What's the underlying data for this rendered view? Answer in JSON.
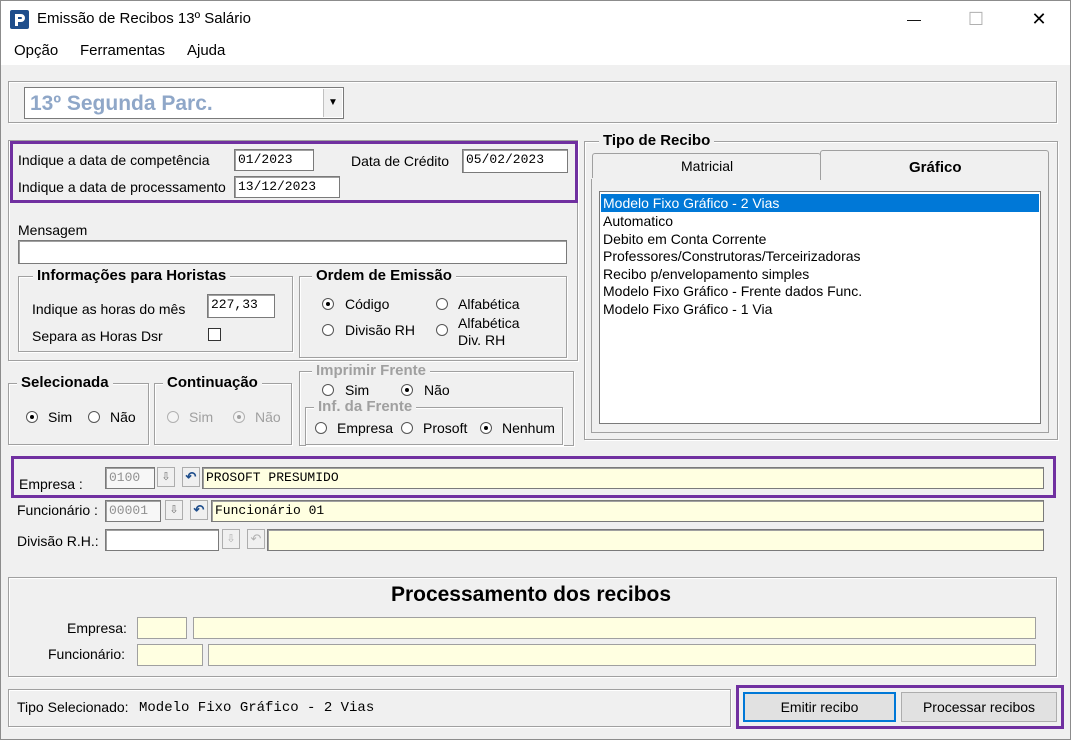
{
  "window": {
    "title": "Emissão de Recibos 13º Salário",
    "minimize": "—",
    "maximize": "☐",
    "close": "✕"
  },
  "menu": [
    "Opção",
    "Ferramentas",
    "Ajuda"
  ],
  "parcel_select": {
    "value": "13º Segunda Parc."
  },
  "dates": {
    "competencia_label": "Indique a data de competência",
    "competencia_value": "01/2023",
    "processamento_label": "Indique a data de processamento",
    "processamento_value": "13/12/2023",
    "credito_label": "Data de Crédito",
    "credito_value": "05/02/2023"
  },
  "mensagem": {
    "label": "Mensagem",
    "value": ""
  },
  "horistas": {
    "title": "Informações para Horistas",
    "horas_label": "Indique as horas do mês",
    "horas_value": "227,33",
    "separa_label": "Separa as Horas Dsr"
  },
  "ordem": {
    "title": "Ordem de Emissão",
    "options": [
      "Código",
      "Alfabética",
      "Divisão RH",
      "Alfabética",
      "Div.  RH"
    ]
  },
  "selecionada": {
    "title": "Selecionada",
    "sim": "Sim",
    "nao": "Não"
  },
  "continuacao": {
    "title": "Continuação",
    "sim": "Sim",
    "nao": "Não"
  },
  "imprimir_frente": {
    "title": "Imprimir Frente",
    "sim": "Sim",
    "nao": "Não"
  },
  "inf_frente": {
    "title": "Inf. da Frente",
    "empresa": "Empresa",
    "prosoft": "Prosoft",
    "nenhum": "Nenhum"
  },
  "tipo_recibo": {
    "title": "Tipo de Recibo",
    "tabs": [
      "Matricial",
      "Gráfico"
    ],
    "items": [
      "Modelo Fixo Gráfico - 2 Vias",
      "Automatico",
      "Debito em Conta Corrente",
      "Professores/Construtoras/Terceirizadoras",
      "Recibo p/envelopamento simples",
      "Modelo Fixo Gráfico - Frente dados Func.",
      "Modelo Fixo Gráfico - 1 Via"
    ]
  },
  "empresa": {
    "label": "Empresa :",
    "code": "0100",
    "name": "PROSOFT PRESUMIDO"
  },
  "funcionario": {
    "label": "Funcionário :",
    "code": "00001",
    "name": "Funcionário 01"
  },
  "divisao": {
    "label": "Divisão R.H.:",
    "code": "",
    "name": ""
  },
  "processamento": {
    "title": "Processamento dos recibos",
    "empresa_label": "Empresa:",
    "funcionario_label": "Funcionário:"
  },
  "status": {
    "label": "Tipo Selecionado:",
    "value": "Modelo Fixo Gráfico - 2 Vias"
  },
  "buttons": {
    "emitir": "Emitir recibo",
    "processar": "Processar recibos"
  },
  "colors": {
    "highlight": "#7030a0",
    "selection": "#0078d7",
    "field_yellow": "#ffffe1"
  }
}
